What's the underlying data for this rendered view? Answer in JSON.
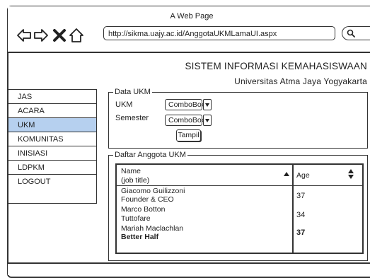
{
  "browser": {
    "title": "A Web Page",
    "url": "http://sikma.uajy.ac.id/AnggotaUKMLamaUI.aspx"
  },
  "header": {
    "system_title": "SISTEM INFORMASI KEMAHASISWAAN",
    "university": "Universitas Atma Jaya Yogyakarta"
  },
  "sidebar": {
    "items": [
      {
        "label": "JAS"
      },
      {
        "label": "ACARA"
      },
      {
        "label": "UKM"
      },
      {
        "label": "KOMUNITAS"
      },
      {
        "label": "INISIASI"
      },
      {
        "label": "LDPKM"
      },
      {
        "label": "LOGOUT"
      }
    ],
    "active_index": 2
  },
  "data_ukm": {
    "legend": "Data UKM",
    "ukm_label": "UKM",
    "ukm_value": "ComboBox",
    "semester_label": "Semester",
    "semester_value": "ComboBox",
    "tampil_label": "Tampil"
  },
  "daftar": {
    "legend": "Daftar Anggota UKM",
    "col_name": "Name",
    "col_name_sub": "(job title)",
    "col_age": "Age",
    "rows": [
      {
        "name": "Giacomo Guilizzoni",
        "title": "Founder & CEO",
        "age": "37"
      },
      {
        "name": "Marco Botton",
        "title": "Tuttofare",
        "age": "34"
      },
      {
        "name": "Mariah Maclachlan",
        "title": "Better Half",
        "age": "37"
      }
    ]
  },
  "colors": {
    "active_item": "#b6d0ef",
    "line": "#333333"
  }
}
